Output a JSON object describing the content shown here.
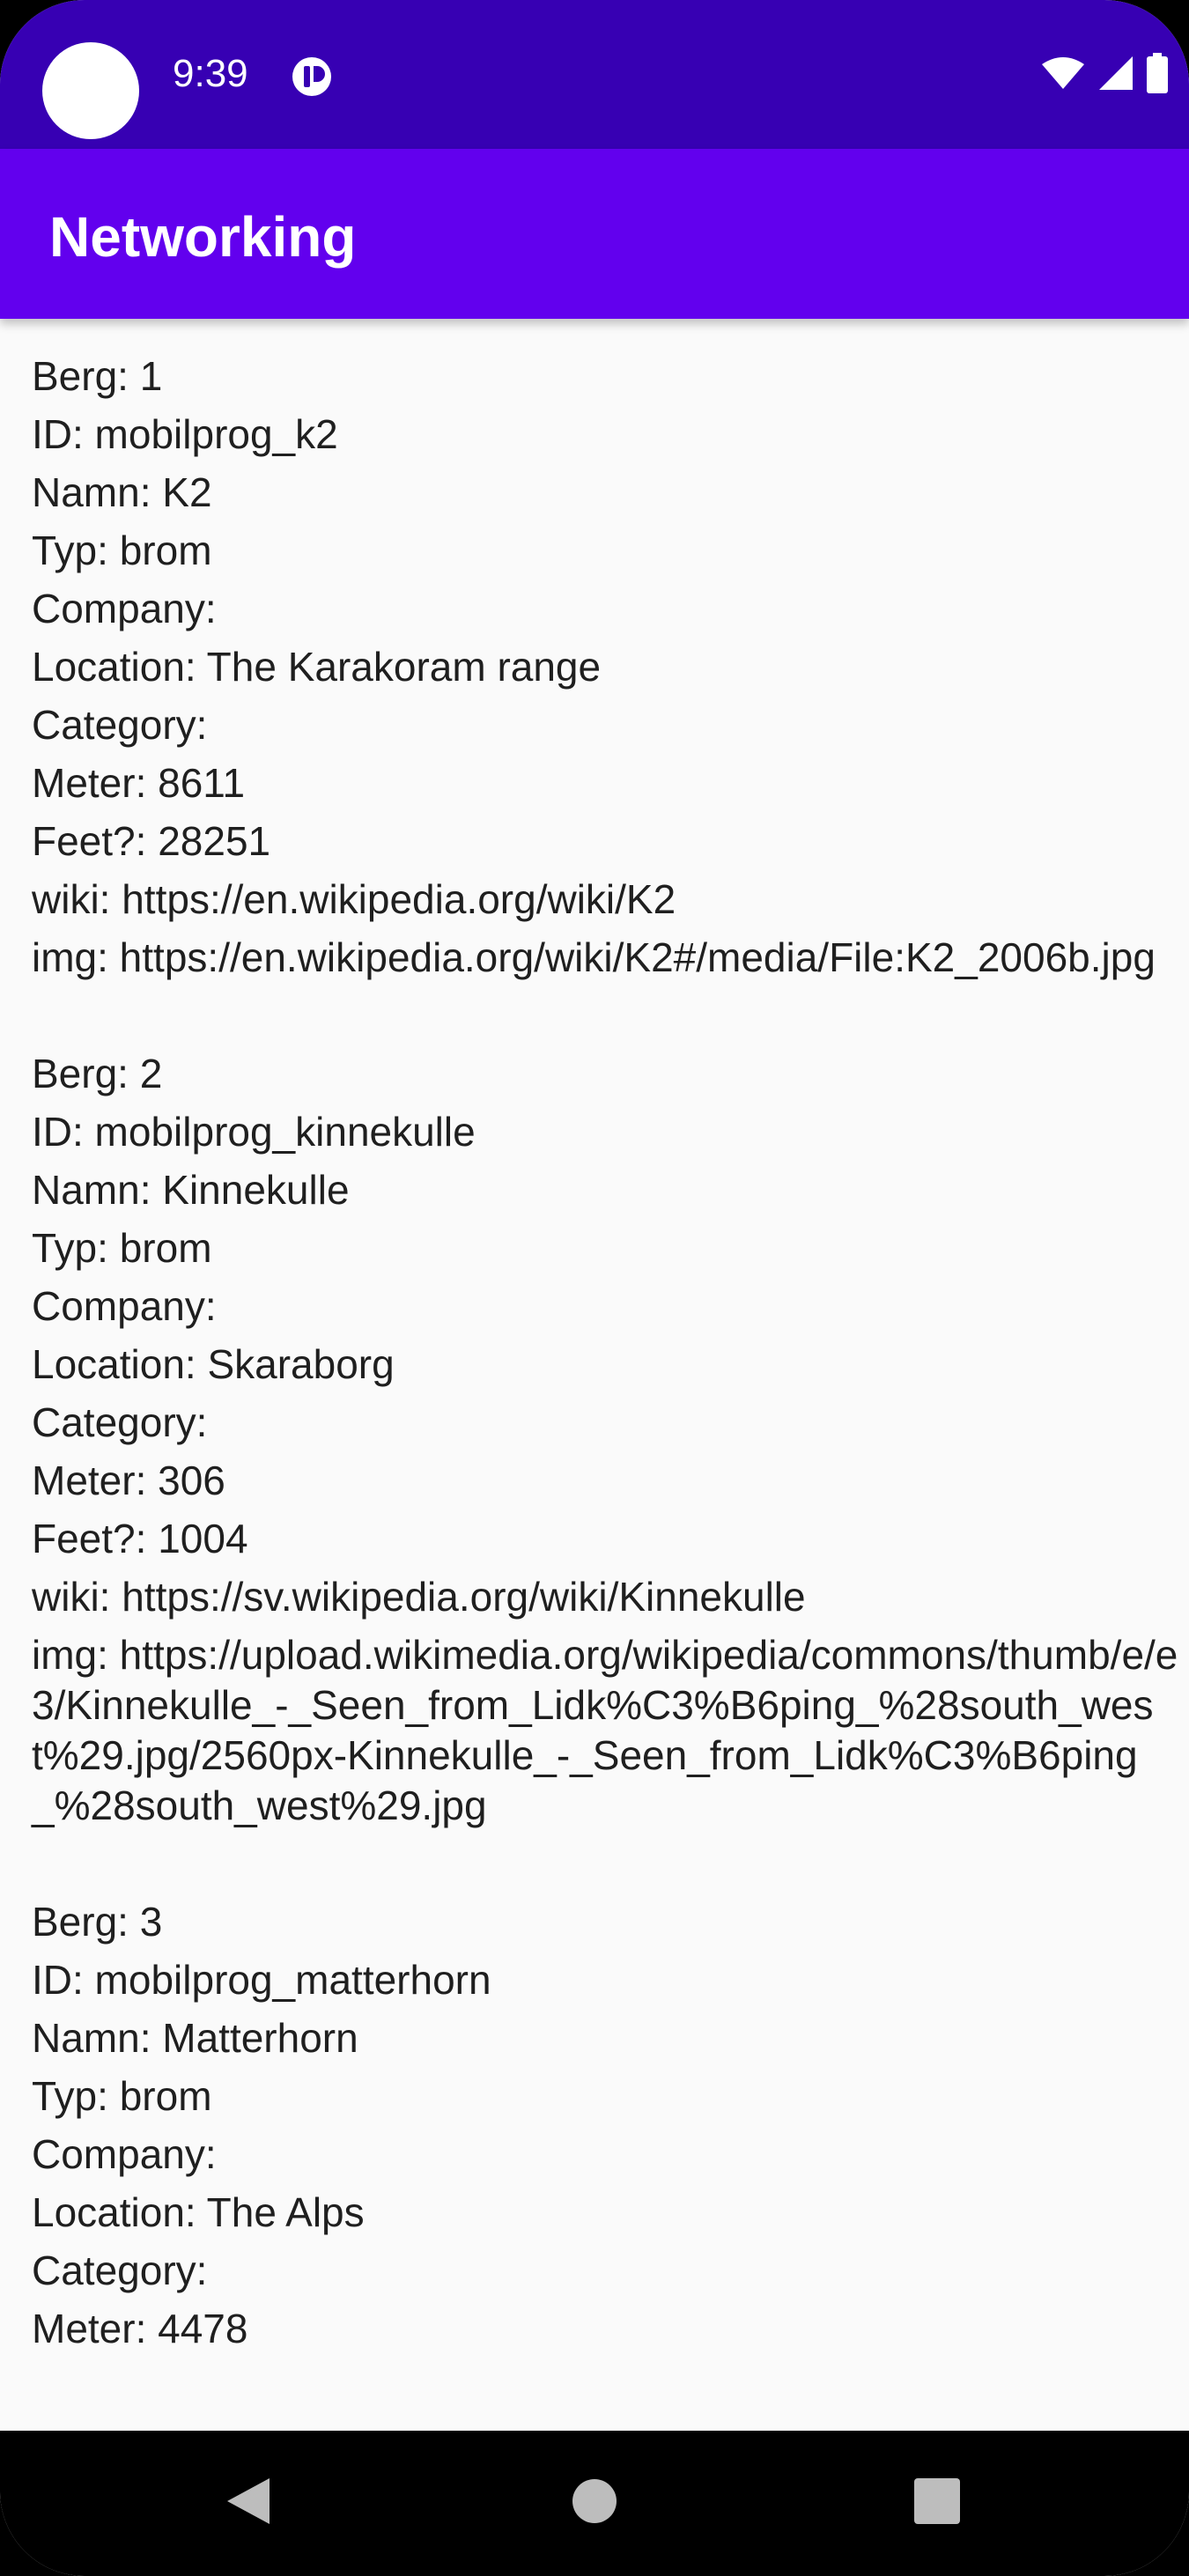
{
  "status_bar": {
    "time": "9:39",
    "icons": [
      "app-notification-icon",
      "wifi-icon",
      "cellular-signal-icon",
      "battery-icon"
    ],
    "background": "#3700b3"
  },
  "app_bar": {
    "title": "Networking",
    "background": "#6200ee"
  },
  "mountains": [
    {
      "lines": [
        "Berg: 1",
        "ID: mobilprog_k2",
        "Namn: K2",
        "Typ: brom",
        "Company:",
        "Location: The Karakoram range",
        "Category:",
        "Meter: 8611",
        "Feet?: 28251",
        "wiki: https://en.wikipedia.org/wiki/K2"
      ],
      "img": "img: https://en.wikipedia.org/wiki/K2#/media/File:K2_2006b.jpg"
    },
    {
      "lines": [
        "Berg: 2",
        "ID: mobilprog_kinnekulle",
        "Namn: Kinnekulle",
        "Typ: brom",
        "Company:",
        "Location: Skaraborg",
        "Category:",
        "Meter: 306",
        "Feet?: 1004",
        "wiki: https://sv.wikipedia.org/wiki/Kinnekulle"
      ],
      "img": "img: https://upload.wikimedia.org/wikipedia/commons/thumb/e/e3/Kinnekulle_-_Seen_from_Lidk%C3%B6ping_%28south_west%29.jpg/2560px-Kinnekulle_-_Seen_from_Lidk%C3%B6ping_%28south_west%29.jpg"
    },
    {
      "lines": [
        "Berg: 3",
        "ID: mobilprog_matterhorn",
        "Namn: Matterhorn",
        "Typ: brom",
        "Company:",
        "Location: The Alps",
        "Category:",
        "Meter: 4478"
      ]
    }
  ],
  "nav_bar": {
    "buttons": [
      "back-icon",
      "home-icon",
      "recents-icon"
    ]
  }
}
